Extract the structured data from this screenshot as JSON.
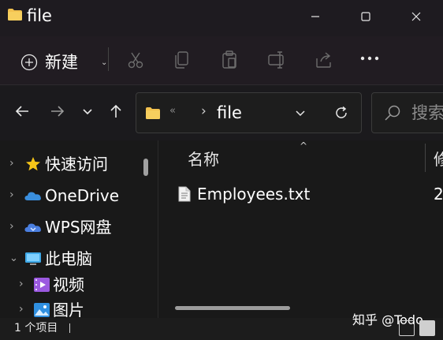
{
  "window": {
    "title": "file",
    "controls": [
      "minimize-icon",
      "maximize-icon",
      "close-icon"
    ]
  },
  "toolbar": {
    "new_label": "新建",
    "actions": [
      "cut-icon",
      "copy-icon",
      "paste-icon",
      "rename-icon",
      "share-icon",
      "more-icon"
    ]
  },
  "nav": {
    "buttons": [
      "back-icon",
      "forward-icon",
      "recent-dropdown-icon",
      "up-icon"
    ]
  },
  "address": {
    "overflow": "«",
    "path_segment": "file"
  },
  "search": {
    "placeholder": "搜索"
  },
  "sidebar": {
    "items": [
      {
        "label": "快速访问",
        "icon": "star-icon",
        "color": "#f5c518",
        "expandable": true
      },
      {
        "label": "OneDrive",
        "icon": "onedrive-cloud-icon",
        "color": "#3a8fde",
        "expandable": true
      },
      {
        "label": "WPS网盘",
        "icon": "wps-cloud-icon",
        "color": "#4a7fe0",
        "expandable": true
      },
      {
        "label": "此电脑",
        "icon": "computer-icon",
        "color": "#3fa9e8",
        "expandable": true,
        "expanded": true
      },
      {
        "label": "视频",
        "icon": "video-icon",
        "color": "#9b59e0",
        "expandable": true
      },
      {
        "label": "图片",
        "icon": "pictures-icon",
        "color": "#2f8fe0",
        "expandable": true
      }
    ]
  },
  "content": {
    "columns": {
      "name": "名称",
      "date": "修"
    },
    "files": [
      {
        "name": "Employees.txt",
        "date": "2"
      }
    ]
  },
  "status": {
    "count_text": "1 个项目"
  },
  "watermark": "知乎 @Todo"
}
